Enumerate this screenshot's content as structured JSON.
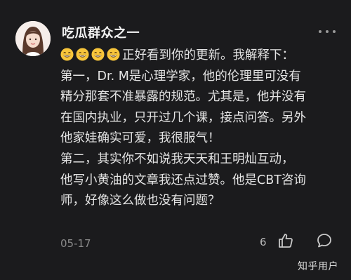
{
  "comment": {
    "username": "吃瓜群众之一",
    "emoji_icons": [
      "grinning-face-emoji",
      "grinning-face-emoji",
      "grinning-face-emoji",
      "grinning-face-emoji"
    ],
    "lines": [
      "正好看到你的更新。我解释下：",
      "第一，Dr. M是心理学家，他的伦理里可没有",
      "精分那套不准暴露的规范。尤其是，他并没有",
      "在国内执业，只开过几个课，接点问答。另外",
      "他家娃确实可爱，我很服气！",
      "第二，其实你不如说我天天和王明灿互动，",
      "他写小黄油的文章我还点过赞。他是CBT咨询",
      "师，好像这么做也没有问题？"
    ],
    "date": "05-17",
    "like_count": "6"
  },
  "watermark": "知乎用户",
  "colors": {
    "background": "#1b1b1d",
    "text": "#e4e4e4",
    "muted": "#8a8a8a"
  }
}
